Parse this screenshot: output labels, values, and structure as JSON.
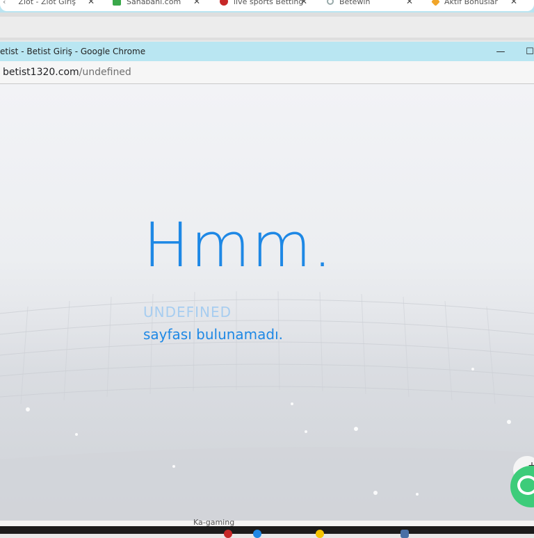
{
  "background_tabs": [
    {
      "label": "Ziot - Ziot Giriş",
      "favicon": "ring-icon"
    },
    {
      "label": "Sahabahl.com",
      "favicon": "green-square-icon"
    },
    {
      "label": "live sports Betting",
      "favicon": "red-circle-icon"
    },
    {
      "label": "Betewin",
      "favicon": "ring-icon"
    },
    {
      "label": "Aktif Bonuslar",
      "favicon": "star-icon"
    }
  ],
  "window": {
    "title": "etist - Betist Giriş - Google Chrome",
    "minimize_glyph": "—",
    "maximize_glyph": "☐"
  },
  "address": {
    "host": "betist1320.com",
    "path": "/undefined"
  },
  "page": {
    "headline": "Hmm.",
    "page_name": "UNDEFINED",
    "message": "sayfası bulunamadı."
  },
  "bottom": {
    "label": "Ka-gaming"
  },
  "colors": {
    "accent": "#1e88e5",
    "accent_light": "#a7cdf0",
    "titlebar": "#b9e6f2",
    "chat": "#3dcc7a"
  }
}
